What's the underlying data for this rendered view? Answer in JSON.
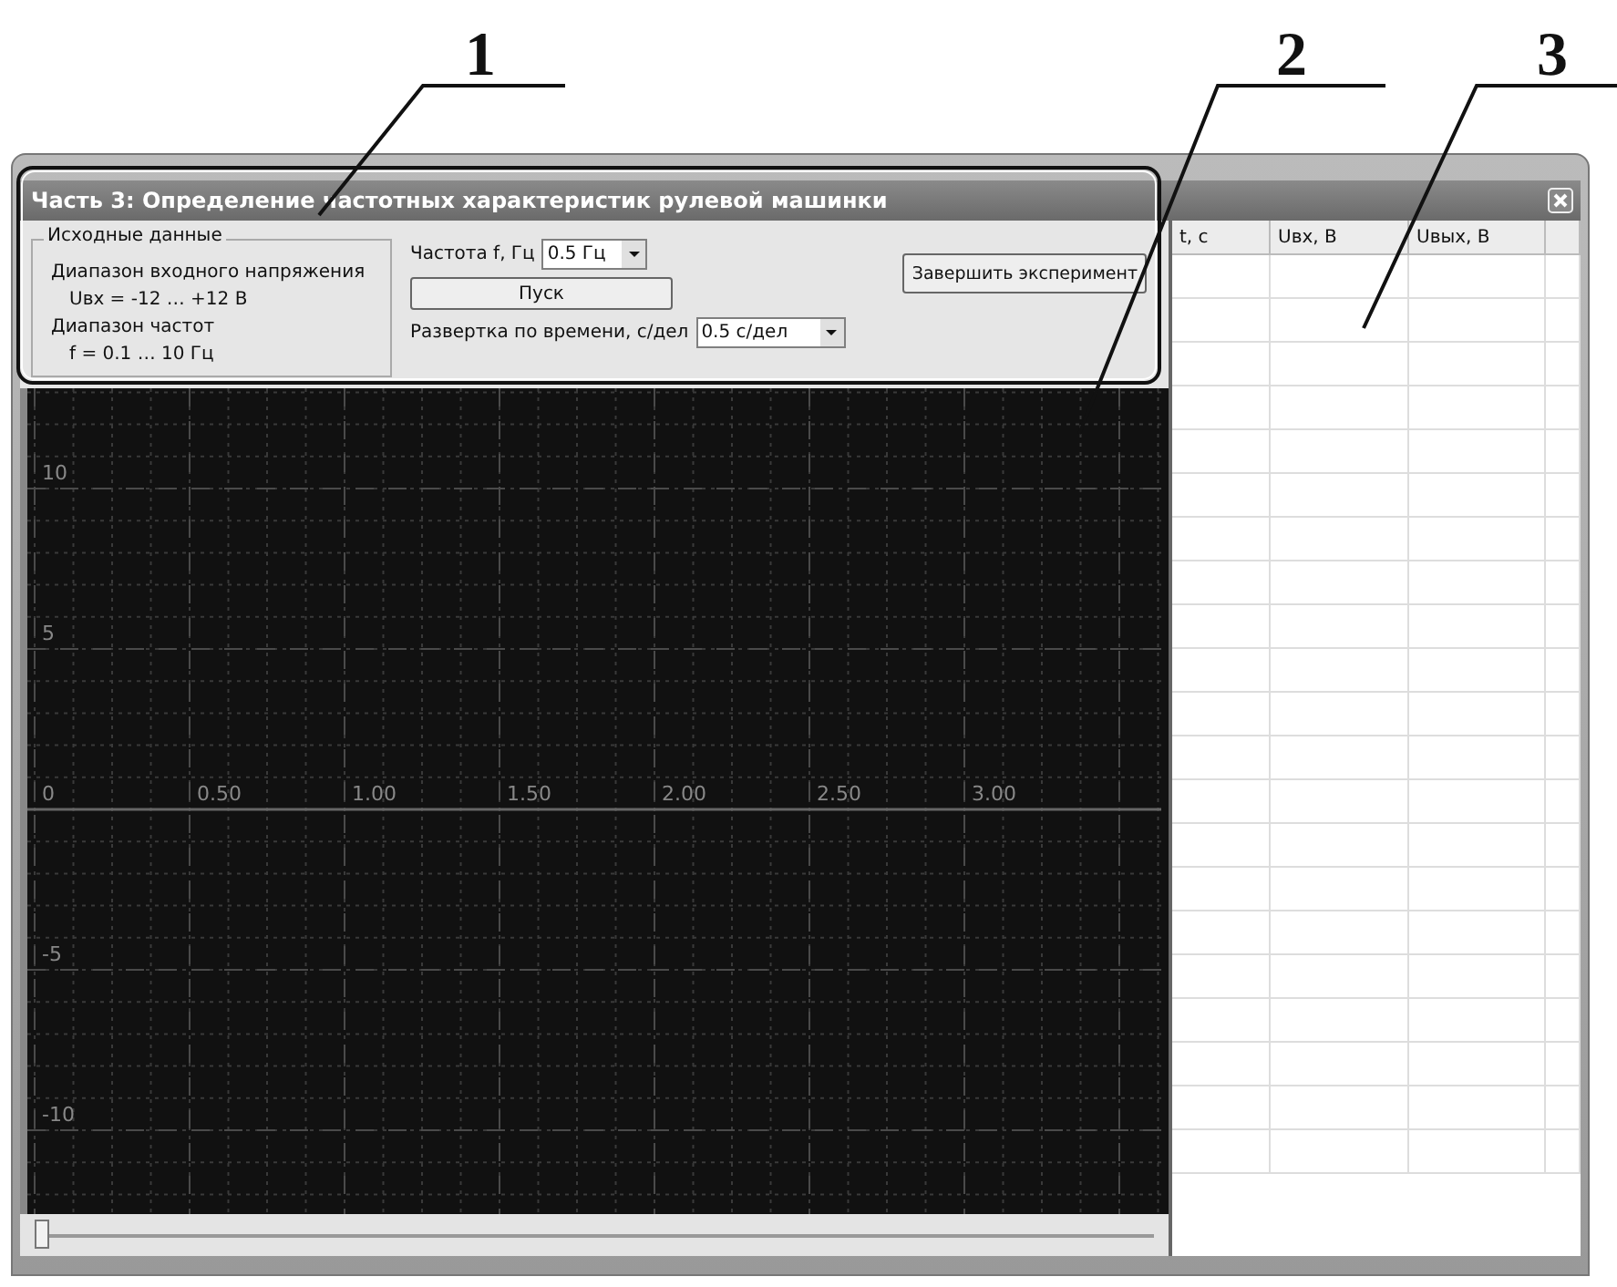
{
  "callouts": [
    "1",
    "2",
    "3"
  ],
  "window": {
    "title": "Часть 3: Определение частотных характеристик рулевой машинки"
  },
  "source_group": {
    "title": "Исходные данные",
    "lines": [
      {
        "text": "Диапазон входного напряжения",
        "indent": false
      },
      {
        "text": "Uвх = -12 … +12 В",
        "indent": true
      },
      {
        "text": "Диапазон частот",
        "indent": false
      },
      {
        "text": "f = 0.1 … 10 Гц",
        "indent": true
      }
    ]
  },
  "frequency": {
    "label": "Частота f, Гц",
    "value": "0.5 Гц"
  },
  "start_button": "Пуск",
  "sweep": {
    "label": "Развертка по времени, с/дел",
    "value": "0.5 с/дел"
  },
  "finish_button": "Завершить эксперимент",
  "plot": {
    "y_labels": [
      "10",
      "5",
      "0",
      "-5",
      "-10"
    ],
    "x_labels": [
      "0.50",
      "1.00",
      "1.50",
      "2.00",
      "2.50",
      "3.00"
    ]
  },
  "scroll": {
    "level": 0
  },
  "table": {
    "columns": [
      "t, c",
      "Uвх, В",
      "Uвых, В"
    ]
  }
}
